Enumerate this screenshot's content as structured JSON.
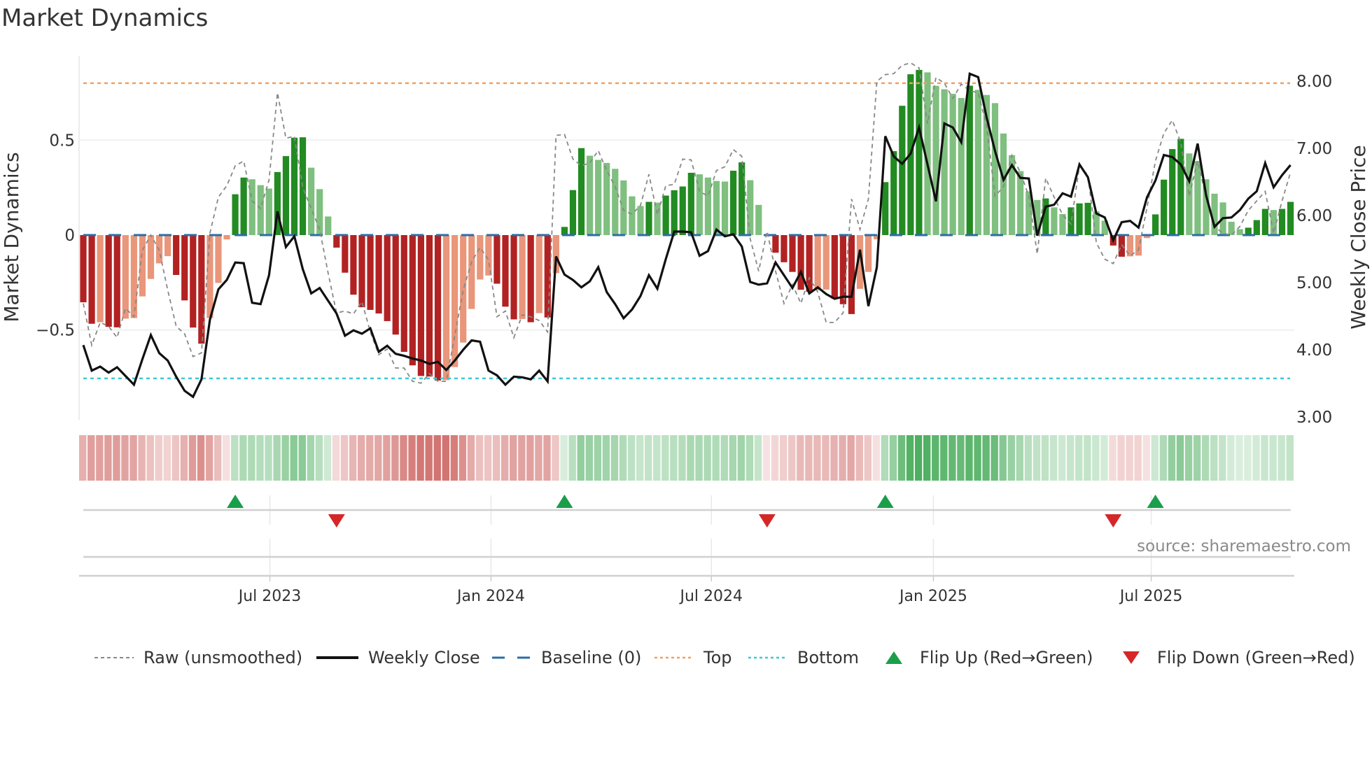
{
  "title": "Market Dynamics",
  "source": "source: sharemaestro.com",
  "legend": [
    {
      "label": "Raw (unsmoothed)",
      "icon": "dotted-gray-line"
    },
    {
      "label": "Weekly Close",
      "icon": "solid-black-line"
    },
    {
      "label": "Baseline (0)",
      "icon": "dashed-blue-line"
    },
    {
      "label": "Top",
      "icon": "dotted-orange-line"
    },
    {
      "label": "Bottom",
      "icon": "dotted-cyan-line"
    },
    {
      "label": "Flip Up (Red→Green)",
      "icon": "triangle-up"
    },
    {
      "label": "Flip Down (Green→Red)",
      "icon": "triangle-down"
    }
  ],
  "colors": {
    "pos_strong": "#228b22",
    "pos_weak": "#7fbf7f",
    "neg_strong": "#b22222",
    "neg_weak": "#e9967a",
    "raw": "#888888",
    "close": "#111111",
    "baseline": "#2b6ea6",
    "top": "#f0a060",
    "bottom": "#3cc8d8",
    "flip_up": "#1a9e4a",
    "flip_down": "#d62728"
  },
  "chart_data": {
    "type": "bar+line",
    "title": "Market Dynamics",
    "ylabel": "Market Dynamics",
    "y2label": "Weekly Close Price",
    "ylim": [
      -0.973,
      0.943
    ],
    "y2lim": [
      2.8,
      8.5
    ],
    "y_ticks": [
      {
        "value": 0.5,
        "label": "0.5"
      },
      {
        "value": 0,
        "label": "0"
      },
      {
        "value": -0.5,
        "label": "−0.5"
      }
    ],
    "y2_ticks": [
      {
        "value": 8,
        "label": "8.00"
      },
      {
        "value": 7,
        "label": "7.00"
      },
      {
        "value": 6,
        "label": "6.00"
      },
      {
        "value": 5,
        "label": "5.00"
      },
      {
        "value": 4,
        "label": "4.00"
      },
      {
        "value": 3,
        "label": "3.00"
      }
    ],
    "x_unit": "week index",
    "x_ticks": [
      {
        "week": 22.1,
        "label": "Jul 2023"
      },
      {
        "week": 48.3,
        "label": "Jan 2024"
      },
      {
        "week": 74.4,
        "label": "Jul 2024"
      },
      {
        "week": 100.7,
        "label": "Jan 2025"
      },
      {
        "week": 126.5,
        "label": "Jul 2025"
      }
    ],
    "top_level": 0.8,
    "bottom_level": -0.755,
    "baseline": 0,
    "momentum": [
      -0.354,
      -0.467,
      -0.459,
      -0.483,
      -0.486,
      -0.44,
      -0.437,
      -0.323,
      -0.231,
      -0.149,
      -0.111,
      -0.21,
      -0.344,
      -0.487,
      -0.572,
      -0.437,
      -0.252,
      -0.023,
      0.215,
      0.303,
      0.294,
      0.263,
      0.245,
      0.332,
      0.416,
      0.513,
      0.515,
      0.355,
      0.242,
      0.098,
      -0.066,
      -0.198,
      -0.314,
      -0.38,
      -0.394,
      -0.413,
      -0.453,
      -0.524,
      -0.615,
      -0.686,
      -0.742,
      -0.745,
      -0.766,
      -0.764,
      -0.695,
      -0.566,
      -0.389,
      -0.234,
      -0.213,
      -0.256,
      -0.377,
      -0.444,
      -0.442,
      -0.459,
      -0.411,
      -0.434,
      -0.2,
      0.043,
      0.237,
      0.458,
      0.418,
      0.396,
      0.38,
      0.349,
      0.288,
      0.204,
      0.153,
      0.175,
      0.171,
      0.208,
      0.236,
      0.256,
      0.328,
      0.32,
      0.303,
      0.285,
      0.282,
      0.339,
      0.383,
      0.289,
      0.159,
      -0.005,
      -0.093,
      -0.143,
      -0.194,
      -0.288,
      -0.299,
      -0.29,
      -0.287,
      -0.336,
      -0.364,
      -0.416,
      -0.283,
      -0.194,
      -0.022,
      0.279,
      0.442,
      0.681,
      0.847,
      0.87,
      0.857,
      0.786,
      0.768,
      0.744,
      0.722,
      0.787,
      0.765,
      0.738,
      0.695,
      0.535,
      0.421,
      0.337,
      0.23,
      0.185,
      0.193,
      0.146,
      0.111,
      0.146,
      0.167,
      0.17,
      0.125,
      0.076,
      -0.055,
      -0.114,
      -0.112,
      -0.108,
      -0.016,
      0.109,
      0.292,
      0.453,
      0.507,
      0.43,
      0.39,
      0.294,
      0.218,
      0.172,
      0.07,
      0.031,
      0.039,
      0.079,
      0.138,
      0.132,
      0.138,
      0.175
    ],
    "raw": [
      -0.36,
      -0.58,
      -0.46,
      -0.48,
      -0.54,
      -0.385,
      -0.43,
      -0.08,
      0.0,
      -0.08,
      -0.29,
      -0.48,
      -0.52,
      -0.64,
      -0.62,
      0.01,
      0.2,
      0.26,
      0.365,
      0.39,
      0.18,
      0.14,
      0.29,
      0.75,
      0.51,
      0.52,
      0.25,
      0.14,
      0.03,
      -0.2,
      -0.41,
      -0.4,
      -0.415,
      -0.35,
      -0.51,
      -0.63,
      -0.6,
      -0.7,
      -0.7,
      -0.77,
      -0.78,
      -0.73,
      -0.77,
      -0.77,
      -0.53,
      -0.29,
      -0.14,
      -0.065,
      -0.13,
      -0.43,
      -0.4,
      -0.54,
      -0.42,
      -0.43,
      -0.45,
      -0.51,
      0.525,
      0.53,
      0.4,
      0.365,
      0.38,
      0.445,
      0.34,
      0.255,
      0.13,
      0.11,
      0.156,
      0.32,
      0.107,
      0.26,
      0.267,
      0.4,
      0.396,
      0.23,
      0.205,
      0.34,
      0.36,
      0.45,
      0.415,
      -0.02,
      -0.19,
      0.02,
      -0.19,
      -0.36,
      -0.26,
      -0.36,
      -0.225,
      -0.3,
      -0.46,
      -0.46,
      -0.41,
      0.19,
      0.03,
      0.19,
      0.81,
      0.845,
      0.85,
      0.894,
      0.907,
      0.88,
      0.587,
      0.83,
      0.8,
      0.72,
      0.795,
      0.76,
      0.75,
      0.574,
      0.205,
      0.255,
      0.42,
      0.33,
      0.205,
      -0.1,
      0.3,
      0.2,
      0.107,
      0.058,
      0.365,
      0.316,
      -0.04,
      -0.127,
      -0.15,
      -0.05,
      -0.11,
      -0.077,
      0.144,
      0.39,
      0.537,
      0.605,
      0.488,
      0.205,
      0.39,
      0.2,
      0.045,
      0.009,
      0.0,
      0.045,
      0.13,
      0.18,
      0.23,
      0.01,
      0.18,
      0.33
    ],
    "weekly_close": [
      4.06,
      3.68,
      3.74,
      3.65,
      3.73,
      3.6,
      3.47,
      3.85,
      4.21,
      3.94,
      3.83,
      3.59,
      3.38,
      3.29,
      3.55,
      4.44,
      4.89,
      5.03,
      5.29,
      5.28,
      4.69,
      4.67,
      5.1,
      6.05,
      5.52,
      5.68,
      5.19,
      4.83,
      4.91,
      4.72,
      4.53,
      4.2,
      4.28,
      4.23,
      4.31,
      3.96,
      4.05,
      3.93,
      3.9,
      3.86,
      3.83,
      3.78,
      3.81,
      3.69,
      3.83,
      3.99,
      4.13,
      4.11,
      3.68,
      3.61,
      3.47,
      3.59,
      3.58,
      3.55,
      3.68,
      3.52,
      5.38,
      5.11,
      5.03,
      4.92,
      5.01,
      5.22,
      4.85,
      4.67,
      4.46,
      4.59,
      4.79,
      5.1,
      4.9,
      5.34,
      5.75,
      5.75,
      5.74,
      5.39,
      5.46,
      5.78,
      5.68,
      5.71,
      5.53,
      5.0,
      4.96,
      4.98,
      5.29,
      5.1,
      4.91,
      5.15,
      4.83,
      4.92,
      4.82,
      4.75,
      4.78,
      4.78,
      5.48,
      4.64,
      5.22,
      7.17,
      6.87,
      6.76,
      6.91,
      7.3,
      6.75,
      6.2,
      7.36,
      7.3,
      7.08,
      8.1,
      8.05,
      7.45,
      6.95,
      6.52,
      6.74,
      6.55,
      6.54,
      5.69,
      6.12,
      6.15,
      6.32,
      6.27,
      6.75,
      6.56,
      6.02,
      5.96,
      5.62,
      5.89,
      5.91,
      5.81,
      6.26,
      6.51,
      6.89,
      6.86,
      6.75,
      6.5,
      7.06,
      6.29,
      5.82,
      5.95,
      5.96,
      6.07,
      6.24,
      6.35,
      6.77,
      6.41,
      6.59,
      6.74
    ],
    "flip_up_weeks": [
      18,
      57,
      95,
      127
    ],
    "flip_down_weeks": [
      30,
      81,
      122
    ],
    "grid": true,
    "legend_position": "bottom"
  }
}
